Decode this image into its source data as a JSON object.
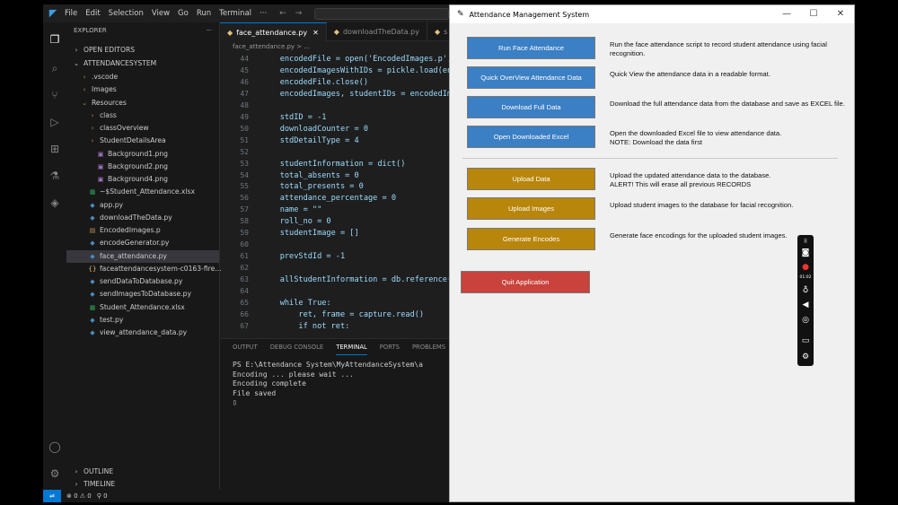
{
  "vscode": {
    "menu": [
      "File",
      "Edit",
      "Selection",
      "View",
      "Go",
      "Run",
      "Terminal",
      "···"
    ],
    "nav": {
      "back": "←",
      "forward": "→"
    },
    "explorer": {
      "title": "EXPLORER",
      "more": "···",
      "open_editors": "OPEN EDITORS",
      "project": "ATTENDANCESYSTEM",
      "tree": [
        {
          "label": ".vscode",
          "icon": "›",
          "depth": 1
        },
        {
          "label": "Images",
          "icon": "›",
          "depth": 1
        },
        {
          "label": "Resources",
          "icon": "⌄",
          "depth": 1
        },
        {
          "label": "class",
          "icon": "›",
          "depth": 2
        },
        {
          "label": "classOverview",
          "icon": "›",
          "depth": 2
        },
        {
          "label": "StudentDetailsArea",
          "icon": "›",
          "depth": 2
        },
        {
          "label": "Background1.png",
          "icon": "▣",
          "depth": 3
        },
        {
          "label": "Background2.png",
          "icon": "▣",
          "depth": 3
        },
        {
          "label": "Background4.png",
          "icon": "▣",
          "depth": 3
        },
        {
          "label": "~$Student_Attendance.xlsx",
          "icon": "▦",
          "depth": 2
        },
        {
          "label": "app.py",
          "icon": "◆",
          "depth": 2
        },
        {
          "label": "downloadTheData.py",
          "icon": "◆",
          "depth": 2
        },
        {
          "label": "EncodedImages.p",
          "icon": "▤",
          "depth": 2
        },
        {
          "label": "encodeGenerator.py",
          "icon": "◆",
          "depth": 2
        },
        {
          "label": "face_attendance.py",
          "icon": "◆",
          "depth": 2
        },
        {
          "label": "faceattendancesystem-c0163-fire...",
          "icon": "{}",
          "depth": 2
        },
        {
          "label": "sendDataToDatabase.py",
          "icon": "◆",
          "depth": 2
        },
        {
          "label": "sendImagesToDatabase.py",
          "icon": "◆",
          "depth": 2
        },
        {
          "label": "Student_Attendance.xlsx",
          "icon": "▦",
          "depth": 2
        },
        {
          "label": "test.py",
          "icon": "◆",
          "depth": 2
        },
        {
          "label": "view_attendance_data.py",
          "icon": "◆",
          "depth": 2
        }
      ],
      "outline": "OUTLINE",
      "timeline": "TIMELINE"
    },
    "tabs": [
      {
        "label": "face_attendance.py",
        "close": "✕",
        "active": true
      },
      {
        "label": "downloadTheData.py",
        "active": false
      },
      {
        "label": "s",
        "active": false
      }
    ],
    "breadcrumb": "face_attendance.py > ...",
    "code": [
      {
        "n": "44",
        "t": "    encodedFile = open('EncodedImages.p',"
      },
      {
        "n": "45",
        "t": "    encodedImagesWithIDs = pickle.load(enc"
      },
      {
        "n": "46",
        "t": "    encodedFile.close()"
      },
      {
        "n": "47",
        "t": "    encodedImages, studentIDs = encodedIma"
      },
      {
        "n": "48",
        "t": ""
      },
      {
        "n": "49",
        "t": "    stdID = -1"
      },
      {
        "n": "50",
        "t": "    downloadCounter = 0"
      },
      {
        "n": "51",
        "t": "    stdDetailType = 4"
      },
      {
        "n": "52",
        "t": ""
      },
      {
        "n": "53",
        "t": "    studentInformation = dict()"
      },
      {
        "n": "54",
        "t": "    total_absents = 0"
      },
      {
        "n": "55",
        "t": "    total_presents = 0"
      },
      {
        "n": "56",
        "t": "    attendance_percentage = 0"
      },
      {
        "n": "57",
        "t": "    name = \"\""
      },
      {
        "n": "58",
        "t": "    roll_no = 0"
      },
      {
        "n": "59",
        "t": "    studentImage = []"
      },
      {
        "n": "60",
        "t": ""
      },
      {
        "n": "61",
        "t": "    prevStdId = -1"
      },
      {
        "n": "62",
        "t": ""
      },
      {
        "n": "63",
        "t": "    allStudentInformation = db.reference(f"
      },
      {
        "n": "64",
        "t": ""
      },
      {
        "n": "65",
        "t": "    while True:"
      },
      {
        "n": "66",
        "t": "        ret, frame = capture.read()"
      },
      {
        "n": "67",
        "t": "        if not ret:"
      }
    ],
    "panel_tabs": [
      "OUTPUT",
      "DEBUG CONSOLE",
      "TERMINAL",
      "PORTS",
      "PROBLEMS"
    ],
    "terminal": [
      "PS E:\\Attendance System\\MyAttendanceSystem\\a",
      "Encoding ... please wait ...",
      "Encoding complete",
      "File saved",
      "▯"
    ],
    "status": {
      "errors": "⊗ 0 ⚠ 0",
      "ports": "⚲ 0"
    }
  },
  "app": {
    "title": "Attendance Management System",
    "controls": {
      "minimize": "—",
      "maximize": "☐",
      "close": "✕"
    },
    "buttons": [
      {
        "label": "Run Face Attendance",
        "desc": "Run the face attendance script to record student attendance using facial recognition.",
        "color": "blue"
      },
      {
        "label": "Quick OverView Attendance Data",
        "desc": "Quick View the attendance data in a readable format.",
        "color": "blue"
      },
      {
        "label": "Download Full Data",
        "desc": "Download the full attendance data from the database and save as EXCEL file.",
        "color": "blue"
      },
      {
        "label": "Open Downloaded Excel",
        "desc": "Open the downloaded Excel file to view attendance data.\nNOTE: Download the data first",
        "color": "blue"
      },
      {
        "label": "Upload Data",
        "desc": "Upload the updated attendance data to the database.\nALERT! This will erase all previous RECORDS",
        "color": "gold"
      },
      {
        "label": "Upload Images",
        "desc": "Upload student images to the database for facial recognition.",
        "color": "gold"
      },
      {
        "label": "Generate Encodes",
        "desc": "Generate face encodings for the uploaded student images.",
        "color": "gold"
      },
      {
        "label": "Quit Application",
        "desc": "",
        "color": "red"
      }
    ]
  },
  "recorder": {
    "timer": "01:02"
  }
}
